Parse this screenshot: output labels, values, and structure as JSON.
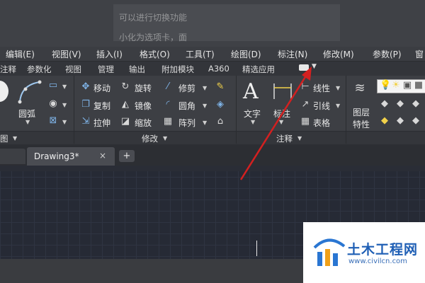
{
  "background_doc": {
    "line1": "可以进行切换功能",
    "line2": "小化为选项卡，面"
  },
  "menu_bar": {
    "items": [
      "编辑(E)",
      "视图(V)",
      "插入(I)",
      "格式(O)",
      "工具(T)",
      "绘图(D)",
      "标注(N)",
      "修改(M)",
      "参数(P)",
      "窗"
    ]
  },
  "ribbon_tabs": {
    "items": [
      "注释",
      "参数化",
      "视图",
      "管理",
      "输出",
      "附加模块",
      "A360",
      "精选应用"
    ]
  },
  "ribbon": {
    "draw": {
      "arc": "圆弧",
      "panel_label": "图"
    },
    "modify": {
      "move": "移动",
      "rotate": "旋转",
      "trim": "修剪",
      "copy": "复制",
      "mirror": "镜像",
      "fillet": "圆角",
      "stretch": "拉伸",
      "scale": "缩放",
      "array": "阵列",
      "panel_label": "修改"
    },
    "annotation": {
      "text": "文字",
      "dimension": "标注",
      "linear": "线性",
      "leader": "引线",
      "table": "表格",
      "panel_label": "注释"
    },
    "layers": {
      "layer_properties_line1": "图层",
      "layer_properties_line2": "特性"
    }
  },
  "doc_tabs": {
    "active": "Drawing3*",
    "close": "×",
    "new": "+"
  },
  "watermark": {
    "title": "土木工程网",
    "url": "www.civilcn.com"
  },
  "colors": {
    "accent_arrow": "#d42020",
    "watermark_blue": "#1f5fb5"
  }
}
